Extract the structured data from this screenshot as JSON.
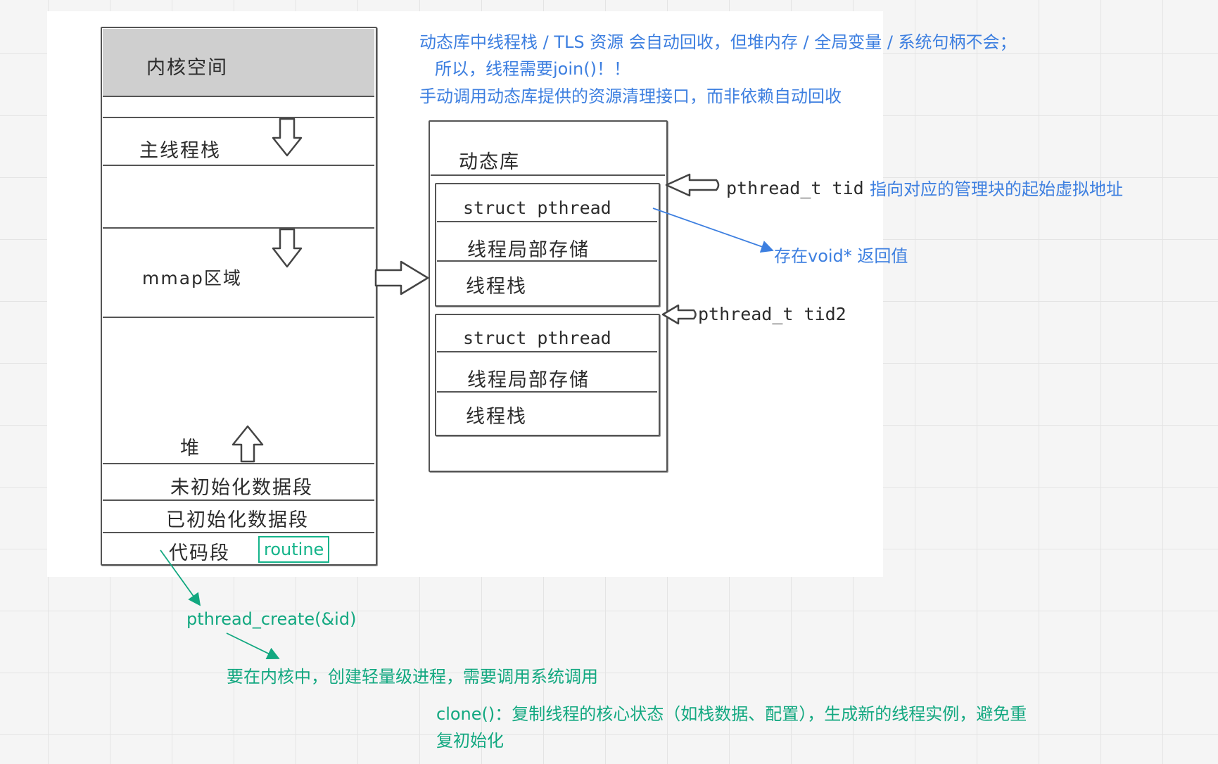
{
  "memory_layout": {
    "kernel": "内核空间",
    "main_stack": "主线程栈",
    "mmap": "mmap区域",
    "heap": "堆",
    "bss": "未初始化数据段",
    "data": "已初始化数据段",
    "text": "代码段",
    "routine": "routine"
  },
  "dynamic_lib": {
    "title": "动态库",
    "blocks": [
      {
        "struct": "struct pthread",
        "tls": "线程局部存储",
        "stack": "线程栈"
      },
      {
        "struct": "struct pthread",
        "tls": "线程局部存储",
        "stack": "线程栈"
      }
    ]
  },
  "tid_labels": {
    "tid1_code": "pthread_t tid",
    "tid1_note": "指向对应的管理块的起始虚拟地址",
    "tid2_code": "pthread_t tid2"
  },
  "notes_blue": {
    "line1": "动态库中线程栈 / TLS 资源 会自动回收，但堆内存 / 全局变量 / 系统句柄不会；",
    "line2": "所以，线程需要join()！！",
    "line3": "手动调用动态库提供的资源清理接口，而非依赖自动回收",
    "retval": "存在void* 返回值"
  },
  "notes_green": {
    "create": "pthread_create(&id)",
    "kernel_call": "要在内核中，创建轻量级进程，需要调用系统调用",
    "clone_line1": "clone()：复制线程的核心状态（如栈数据、配置），生成新的线程实例，避免重",
    "clone_line2": "复初始化"
  },
  "colors": {
    "blue_annotation": "#3d7fe0",
    "green_annotation": "#12a880",
    "sketch_line": "#555555"
  }
}
